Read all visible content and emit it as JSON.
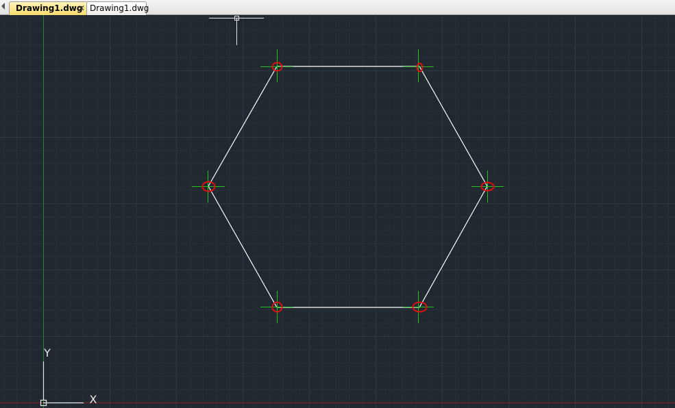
{
  "tabs": [
    {
      "label": "Drawing1.dwg",
      "active": true,
      "close_glyph": "✕"
    },
    {
      "label": "Drawing1.dwg",
      "active": false
    }
  ],
  "ucs": {
    "x_label": "X",
    "y_label": "Y"
  },
  "colors": {
    "background": "#212830",
    "grid_minor": "#283039",
    "grid_major": "#303a45",
    "geometry": "#ffffff",
    "grip_crosshair": "#22c322",
    "grip_marker": "#e01010",
    "y_axis": "#1e8a2a",
    "x_axis_edge": "#8a2020",
    "ucs_icon": "#e8e8e8"
  },
  "icons": [
    "tab-scroll-left-icon",
    "tab-close-icon",
    "ucs-icon",
    "cursor-crosshair-icon"
  ]
}
